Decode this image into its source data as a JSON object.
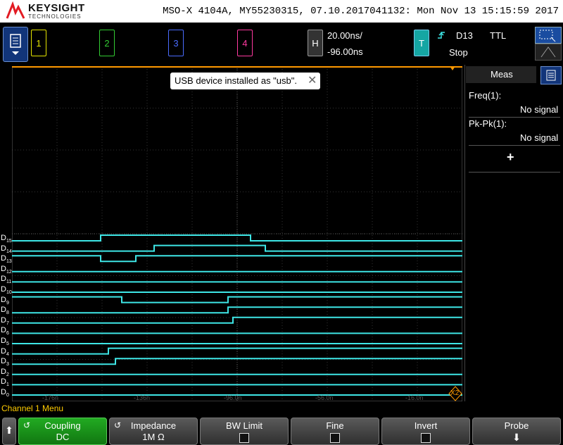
{
  "header": {
    "brand": "KEYSIGHT",
    "brand_sub": "TECHNOLOGIES",
    "info": "MSO-X 4104A, MY55230315, 07.10.2017041132: Mon Nov 13 15:15:59 2017"
  },
  "topbar": {
    "channels": [
      {
        "label": "1",
        "color": "#e6e600"
      },
      {
        "label": "2",
        "color": "#33cc33"
      },
      {
        "label": "3",
        "color": "#4a6cff"
      },
      {
        "label": "4",
        "color": "#ff3aa0"
      }
    ],
    "horizontal": {
      "label": "H",
      "time_per_div": "20.00ns/",
      "delay": "-96.00ns"
    },
    "trigger": {
      "label": "T",
      "source": "D13",
      "type": "TTL",
      "status": "Stop"
    }
  },
  "toast": {
    "message": "USB device installed as \"usb\"."
  },
  "meas": {
    "title": "Meas",
    "items": [
      {
        "name": "Freq(1):",
        "value": "No signal"
      },
      {
        "name": "Pk-Pk(1):",
        "value": "No signal"
      }
    ],
    "add_label": "+"
  },
  "digital": {
    "labels": [
      "D15",
      "D14",
      "D13",
      "D12",
      "D11",
      "D10",
      "D9",
      "D8",
      "D7",
      "D6",
      "D5",
      "D4",
      "D3",
      "D2",
      "D1",
      "D0"
    ],
    "trace_color": "#3ee6e6",
    "grid_marker": "X2"
  },
  "time_axis": [
    "-176n",
    "-136n",
    "-96.0n",
    "-56.0n",
    "-16.0n"
  ],
  "menu": {
    "title": "Channel 1 Menu",
    "keys": [
      {
        "label": "Coupling",
        "value": "DC"
      },
      {
        "label": "Impedance",
        "value": "1M Ω"
      },
      {
        "label": "BW Limit",
        "value": ""
      },
      {
        "label": "Fine",
        "value": ""
      },
      {
        "label": "Invert",
        "value": ""
      },
      {
        "label": "Probe",
        "value": ""
      }
    ]
  },
  "colors": {
    "accent_yellow": "#ffcc00",
    "trigger_teal": "#15a6a3",
    "menu_blue": "#12357a",
    "coupling_green": "#1a8a1a"
  }
}
